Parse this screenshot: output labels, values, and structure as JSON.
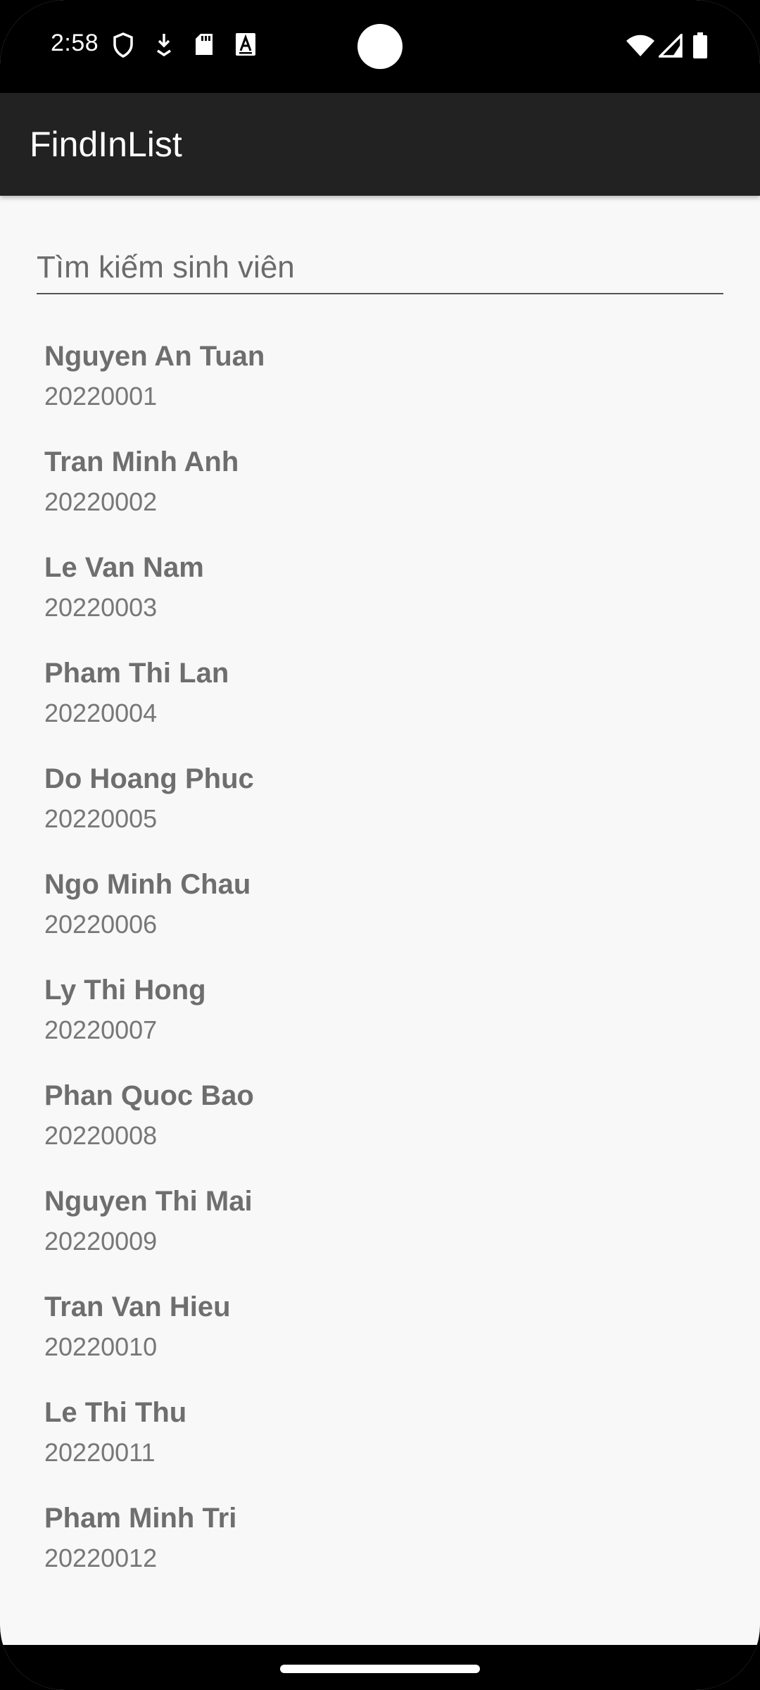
{
  "status_bar": {
    "time": "2:58",
    "left_icons": [
      "shield-icon",
      "download-icon",
      "sd-card-icon",
      "font-a-icon"
    ],
    "right_icons": [
      "wifi-icon",
      "signal-icon",
      "battery-icon"
    ]
  },
  "app_bar": {
    "title": "FindInList"
  },
  "search": {
    "placeholder": "Tìm kiếm sinh viên",
    "value": ""
  },
  "students": [
    {
      "name": "Nguyen An Tuan",
      "id": "20220001"
    },
    {
      "name": "Tran Minh Anh",
      "id": "20220002"
    },
    {
      "name": "Le Van Nam",
      "id": "20220003"
    },
    {
      "name": "Pham Thi Lan",
      "id": "20220004"
    },
    {
      "name": "Do Hoang Phuc",
      "id": "20220005"
    },
    {
      "name": "Ngo Minh Chau",
      "id": "20220006"
    },
    {
      "name": "Ly Thi Hong",
      "id": "20220007"
    },
    {
      "name": "Phan Quoc Bao",
      "id": "20220008"
    },
    {
      "name": "Nguyen Thi Mai",
      "id": "20220009"
    },
    {
      "name": "Tran Van Hieu",
      "id": "20220010"
    },
    {
      "name": "Le Thi Thu",
      "id": "20220011"
    },
    {
      "name": "Pham Minh Tri",
      "id": "20220012"
    }
  ]
}
